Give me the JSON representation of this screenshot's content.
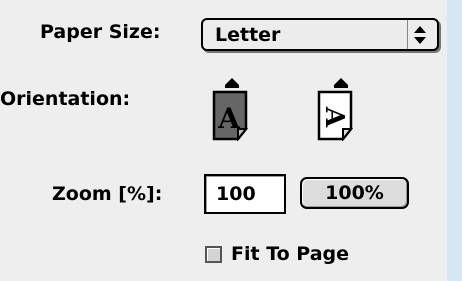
{
  "paper_size": {
    "label": "Paper Size:",
    "selected": "Letter"
  },
  "orientation": {
    "label": "Orientation:",
    "options": [
      {
        "name": "portrait",
        "glyph": "A",
        "selected": true
      },
      {
        "name": "landscape",
        "glyph": "A",
        "selected": false
      }
    ]
  },
  "zoom": {
    "label": "Zoom [%]:",
    "value": "100",
    "reset_label": "100%"
  },
  "fit_to_page": {
    "label": "Fit To Page",
    "checked": false
  },
  "colors": {
    "background": "#d6e7f3",
    "panel": "#eeeeee",
    "selected_orientation": "#666666"
  },
  "icons": [
    "updown-arrows-icon",
    "portrait-orientation-icon",
    "landscape-orientation-icon"
  ]
}
